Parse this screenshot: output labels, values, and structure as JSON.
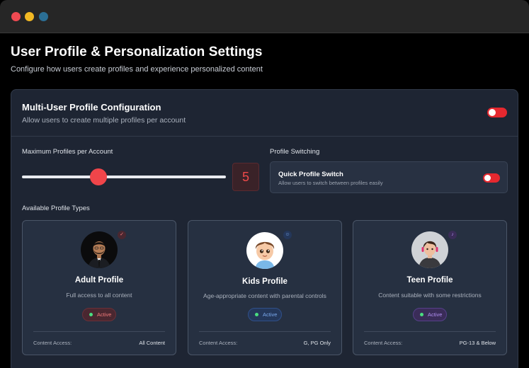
{
  "window": {
    "dots": [
      "#ef4a52",
      "#f2b823",
      "#2b6f95"
    ]
  },
  "header": {
    "title": "User Profile & Personalization Settings",
    "subtitle": "Configure how users create profiles and experience personalized content"
  },
  "multi_user": {
    "title": "Multi-User Profile Configuration",
    "description": "Allow users to create multiple profiles per account",
    "enabled": true
  },
  "max_profiles": {
    "label": "Maximum Profiles per Account",
    "value": "5",
    "fill_fraction": 0.375
  },
  "profile_switching": {
    "label": "Profile Switching",
    "card_title": "Quick Profile Switch",
    "card_desc": "Allow users to switch between profiles easily",
    "enabled": true
  },
  "profile_types": {
    "label": "Available Profile Types",
    "access_label": "Content Access:",
    "cards": [
      {
        "name": "Adult Profile",
        "desc": "Full access to all content",
        "badge": "Active",
        "access": "All Content",
        "accent": "#e5484d",
        "badge_bg": "#4a2730",
        "badge_fg": "#f07a7a",
        "badge_border": "#6b3038",
        "avatar_icon": "adult-avatar-icon"
      },
      {
        "name": "Kids Profile",
        "desc": "Age-appropriate content with parental controls",
        "badge": "Active",
        "access": "G, PG Only",
        "accent": "#3b7bd5",
        "badge_bg": "#24375a",
        "badge_fg": "#7aa9ee",
        "badge_border": "#30508a",
        "avatar_icon": "kid-avatar-icon"
      },
      {
        "name": "Teen Profile",
        "desc": "Content suitable with some restrictions",
        "badge": "Active",
        "access": "PG-13 & Below",
        "accent": "#8b5cd6",
        "badge_bg": "#3a2c58",
        "badge_fg": "#b08ef0",
        "badge_border": "#56408a",
        "avatar_icon": "teen-avatar-icon"
      }
    ]
  },
  "colors": {
    "toggle_on": "#e5282f",
    "slider_thumb": "#f0454a"
  }
}
